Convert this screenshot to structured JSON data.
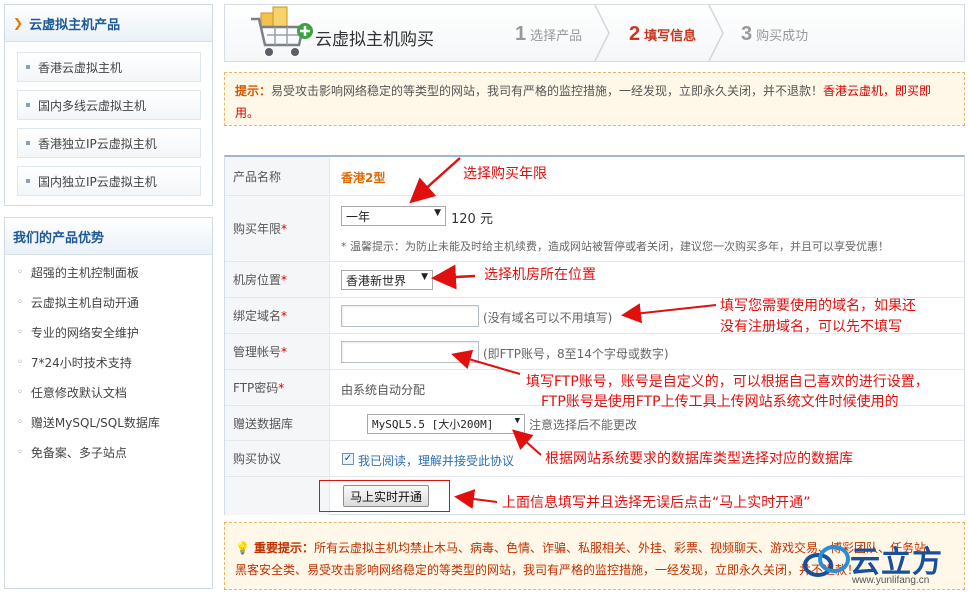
{
  "sidebar": {
    "products_title": "云虚拟主机产品",
    "product_items": [
      {
        "label": "香港云虚拟主机"
      },
      {
        "label": "国内多线云虚拟主机"
      },
      {
        "label": "香港独立IP云虚拟主机"
      },
      {
        "label": "国内独立IP云虚拟主机"
      }
    ],
    "advantages_title": "我们的产品优势",
    "advantage_items": [
      {
        "label": "超强的主机控制面板"
      },
      {
        "label": "云虚拟主机自动开通"
      },
      {
        "label": "专业的网络安全维护"
      },
      {
        "label": "7*24小时技术支持"
      },
      {
        "label": "任意修改默认文档"
      },
      {
        "label": "赠送MySQL/SQL数据库"
      },
      {
        "label": "免备案、多子站点"
      }
    ]
  },
  "header": {
    "title": "云虚拟主机购买",
    "steps": [
      {
        "num": "1",
        "label": "选择产品"
      },
      {
        "num": "2",
        "label": "填写信息"
      },
      {
        "num": "3",
        "label": "购买成功"
      }
    ]
  },
  "notice": {
    "label": "提示：",
    "text": "易受攻击影响网络稳定的等类型的网站，我司有严格的监控措施，一经发现，立即永久关闭，并不退款！",
    "highlight": "香港云虚机，即买即用。"
  },
  "form": {
    "product_label": "产品名称",
    "product_value": "香港2型",
    "period_label": "购买年限",
    "period_selected": "一年",
    "period_price": "120 元",
    "period_tip": "* 温馨提示：为防止未能及时给主机续费，造成网站被暂停或者关闭，建议您一次购买多年，并且可以享受优惠！",
    "datacenter_label": "机房位置",
    "datacenter_selected": "香港新世界",
    "domain_label": "绑定域名",
    "domain_hint": "(没有域名可以不用填写)",
    "account_label": "管理帐号",
    "account_hint": "(即FTP账号，8至14个字母或数字)",
    "ftp_label": "FTP密码",
    "ftp_value": "由系统自动分配",
    "db_label": "赠送数据库",
    "db_selected": "MySQL5.5 [大小200M]",
    "db_hint": "注意选择后不能更改",
    "agreement_label": "购买协议",
    "agreement_read": "我已阅读，",
    "agreement_link": "理解并接受此协议",
    "submit_label": "马上实时开通",
    "required_mark": "*"
  },
  "bottom_notice": {
    "label": "重要提示：",
    "line1": "所有云虚拟主机均禁止木马、病毒、色情、诈骗、私服相关、外挂、彩票、视频聊天、游戏交易、博彩团队、任务站、",
    "line2": "黑客安全类、易受攻击影响网络稳定的等类型的网站，我司有严格的监控措施，一经发现，立即永久关闭，并不退款！"
  },
  "annotations": {
    "period": "选择购买年限",
    "datacenter": "选择机房所在位置",
    "domain_line1": "填写您需要使用的域名，如果还",
    "domain_line2": "没有注册域名，可以先不填写",
    "ftp_line1": "填写FTP账号，账号是自定义的，可以根据自己喜欢的进行设置，",
    "ftp_line2": "FTP账号是使用FTP上传工具上传网站系统文件时候使用的",
    "db": "根据网站系统要求的数据库类型选择对应的数据库",
    "submit": "上面信息填写并且选择无误后点击“马上实时开通”"
  },
  "logo": {
    "text": "云立方",
    "url": "www.yunlifang.cn"
  },
  "colors": {
    "accent_blue": "#1f5a96",
    "annotation_red": "#e0100f",
    "notice_bg": "#fff8e8",
    "product_orange": "#e06a00"
  }
}
